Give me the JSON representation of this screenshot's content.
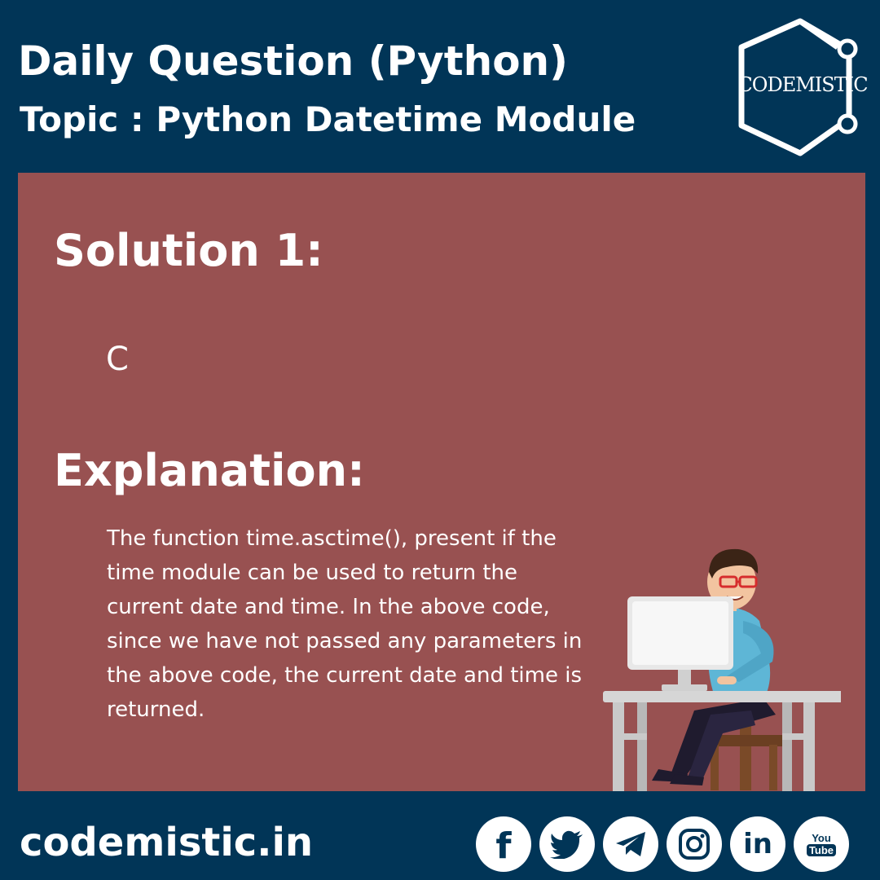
{
  "header": {
    "title": "Daily Question (Python)",
    "topic": "Topic :  Python Datetime Module"
  },
  "logo": {
    "text": "CODEMISTIC"
  },
  "panel": {
    "solution_heading": "Solution 1:",
    "answer": "C",
    "explanation_heading": "Explanation:",
    "explanation_text": "The function time.asctime(), present if the time module can be used to return the current date and time. In the above code, since we have not passed any parameters in the above code, the current date and time is returned."
  },
  "footer": {
    "site": "codemistic.in",
    "socials": [
      {
        "icon": "facebook-icon",
        "label": "f"
      },
      {
        "icon": "twitter-icon",
        "label": ""
      },
      {
        "icon": "telegram-icon",
        "label": ""
      },
      {
        "icon": "instagram-icon",
        "label": ""
      },
      {
        "icon": "linkedin-icon",
        "label": "in"
      },
      {
        "icon": "youtube-icon",
        "label_top": "You",
        "label_bottom": "Tube"
      }
    ]
  },
  "colors": {
    "background": "#013557",
    "panel": "#985151",
    "text": "#ffffff"
  }
}
